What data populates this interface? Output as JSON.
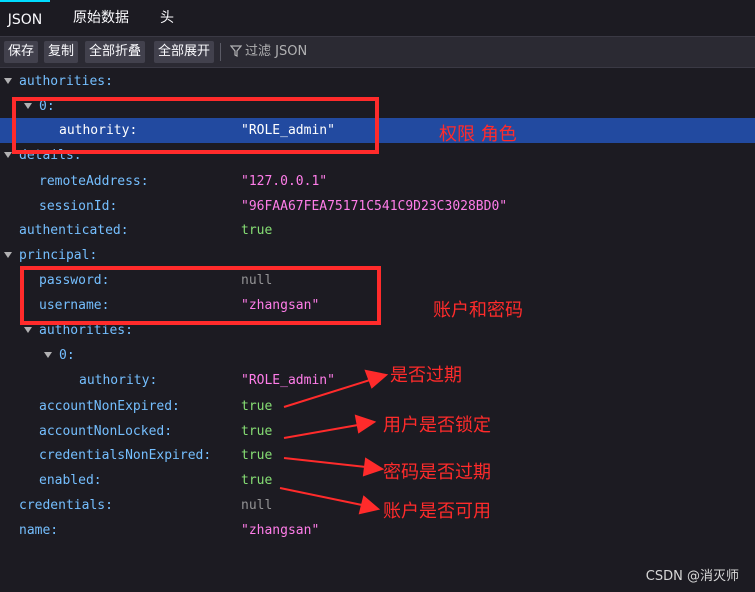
{
  "tabs": [
    {
      "label": "JSON",
      "active": true
    },
    {
      "label": "原始数据",
      "active": false
    },
    {
      "label": "头",
      "active": false
    }
  ],
  "toolbar": {
    "save": "保存",
    "copy": "复制",
    "collapse_all": "全部折叠",
    "expand_all": "全部展开",
    "filter": "过滤 JSON"
  },
  "tree": {
    "authorities_key": "authorities:",
    "idx0_key": "0:",
    "authority_key": "authority:",
    "authority_val": "\"ROLE_admin\"",
    "details_key": "details:",
    "remote_key": "remoteAddress:",
    "remote_val": "\"127.0.0.1\"",
    "session_key": "sessionId:",
    "session_val": "\"96FAA67FEA75171C541C9D23C3028BD0\"",
    "authenticated_key": "authenticated:",
    "authenticated_val": "true",
    "principal_key": "principal:",
    "password_key": "password:",
    "password_val": "null",
    "username_key": "username:",
    "username_val": "\"zhangsan\"",
    "p_authorities_key": "authorities:",
    "p_idx0_key": "0:",
    "p_authority_key": "authority:",
    "p_authority_val": "\"ROLE_admin\"",
    "ane_key": "accountNonExpired:",
    "ane_val": "true",
    "anl_key": "accountNonLocked:",
    "anl_val": "true",
    "cne_key": "credentialsNonExpired:",
    "cne_val": "true",
    "enabled_key": "enabled:",
    "enabled_val": "true",
    "credentials_key": "credentials:",
    "credentials_val": "null",
    "name_key": "name:",
    "name_val": "\"zhangsan\""
  },
  "annotations": {
    "role": "权限  角色",
    "account_password": "账户和密码",
    "expired": "是否过期",
    "locked": "用户是否锁定",
    "cred_expired": "密码是否过期",
    "usable": "账户是否可用"
  },
  "watermark": "CSDN @消灭师",
  "colors": {
    "annotation": "#ff2b2b",
    "selection": "#224aa0",
    "key": "#75bfff",
    "string": "#ff7de9",
    "bool": "#86de74"
  }
}
